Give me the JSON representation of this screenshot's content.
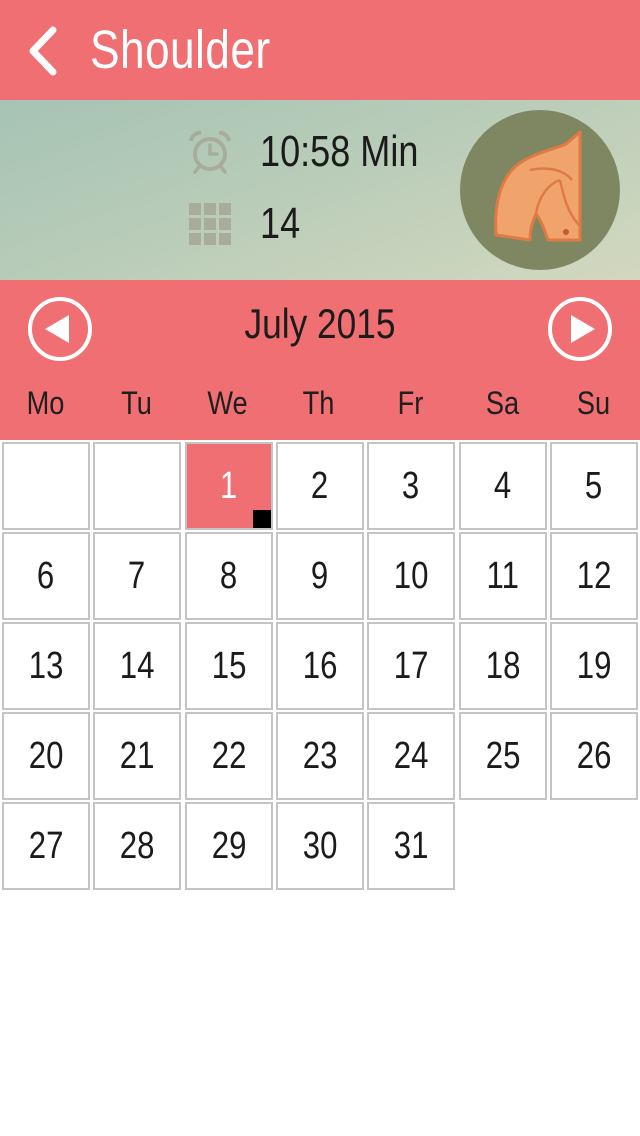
{
  "header": {
    "title": "Shoulder",
    "back_icon": "chevron-left-icon"
  },
  "summary": {
    "duration": "10:58 Min",
    "exercise_count": "14",
    "duration_icon": "alarm-clock-icon",
    "count_icon": "grid-icon",
    "muscle_image": "shoulder-muscle-illustration"
  },
  "calendar": {
    "month_label": "July 2015",
    "prev_icon": "arrow-left-circle-icon",
    "next_icon": "arrow-right-circle-icon",
    "weekdays": [
      "Mo",
      "Tu",
      "We",
      "Th",
      "Fr",
      "Sa",
      "Su"
    ],
    "first_weekday_index": 2,
    "days_in_month": 31,
    "selected_day": 1,
    "days": [
      "1",
      "2",
      "3",
      "4",
      "5",
      "6",
      "7",
      "8",
      "9",
      "10",
      "11",
      "12",
      "13",
      "14",
      "15",
      "16",
      "17",
      "18",
      "19",
      "20",
      "21",
      "22",
      "23",
      "24",
      "25",
      "26",
      "27",
      "28",
      "29",
      "30",
      "31"
    ]
  },
  "colors": {
    "accent": "#ef6f72",
    "muscle_circle": "#7f8762",
    "muscle_fill": "#f0a46b",
    "icon_gray": "#a7ad9a"
  }
}
